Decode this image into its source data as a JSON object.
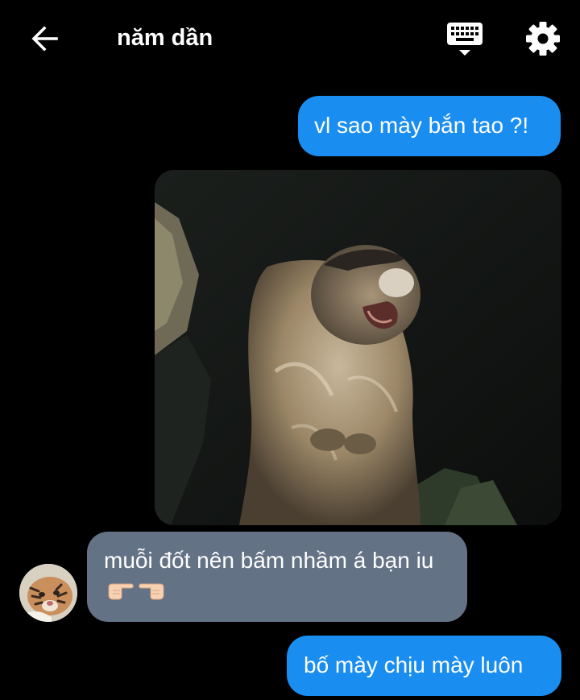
{
  "header": {
    "title": "năm dần",
    "back_icon": "arrow-left-icon",
    "keyboard_icon": "keyboard-icon",
    "settings_icon": "gear-icon"
  },
  "messages": [
    {
      "direction": "outgoing",
      "type": "text",
      "text": "vl sao mày bắn tao ?!"
    },
    {
      "direction": "outgoing",
      "type": "image",
      "image_description_icon": "marmot-screaming-photo"
    },
    {
      "direction": "incoming",
      "type": "text",
      "text": "muỗi đốt nên bấm nhầm á bạn iu",
      "emoji_icons": [
        "pointing-right-hand-icon",
        "pointing-left-hand-icon"
      ]
    },
    {
      "direction": "outgoing",
      "type": "text",
      "text": "bố mày chịu mày luôn"
    }
  ],
  "colors": {
    "background": "#000000",
    "outgoing_bubble": "#1a8df0",
    "incoming_bubble": "#637285",
    "text": "#ffffff"
  }
}
